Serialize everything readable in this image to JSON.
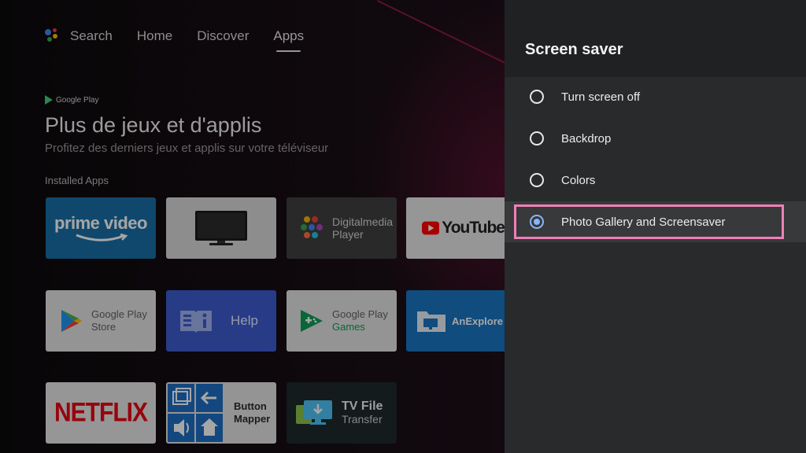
{
  "nav": {
    "items": [
      {
        "label": "Search"
      },
      {
        "label": "Home"
      },
      {
        "label": "Discover"
      },
      {
        "label": "Apps"
      }
    ]
  },
  "hero": {
    "badge": "Google Play",
    "title": "Plus de jeux et d'applis",
    "subtitle": "Profitez des derniers jeux et applis sur votre téléviseur"
  },
  "section": {
    "label": "Installed Apps"
  },
  "apps": {
    "prime": {
      "line1": "prime video"
    },
    "digitalmedia": {
      "line1": "Digitalmedia",
      "line2": "Player"
    },
    "youtube": {
      "label": "YouTube"
    },
    "playstore": {
      "line1": "Google Play",
      "line2": "Store"
    },
    "help": {
      "label": "Help"
    },
    "playgames": {
      "line1": "Google Play",
      "line2": "Games"
    },
    "anexplorer": {
      "label": "AnExplore"
    },
    "netflix": {
      "label": "NETFLIX"
    },
    "buttonmapper": {
      "line1": "Button",
      "line2": "Mapper"
    },
    "tvfile": {
      "line1": "TV File",
      "line2": "Transfer"
    }
  },
  "panel": {
    "title": "Screen saver",
    "options": [
      {
        "label": "Turn screen off",
        "selected": false
      },
      {
        "label": "Backdrop",
        "selected": false
      },
      {
        "label": "Colors",
        "selected": false
      },
      {
        "label": "Photo Gallery and Screensaver",
        "selected": true
      }
    ]
  },
  "colors": {
    "accent": "#8ab4f8",
    "focus": "#f07fb6"
  }
}
